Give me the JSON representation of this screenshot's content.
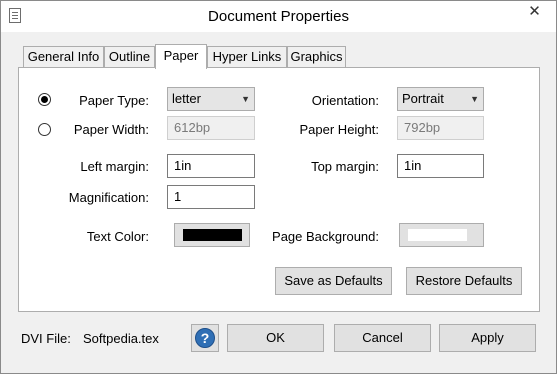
{
  "window": {
    "title": "Document Properties",
    "close_glyph": "✕"
  },
  "tabs": [
    {
      "label": "General Info"
    },
    {
      "label": "Outline"
    },
    {
      "label": "Paper"
    },
    {
      "label": "Hyper Links"
    },
    {
      "label": "Graphics"
    }
  ],
  "paper": {
    "paper_type_label": "Paper Type:",
    "paper_type_value": "letter",
    "paper_type_selected": true,
    "orientation_label": "Orientation:",
    "orientation_value": "Portrait",
    "paper_width_label": "Paper Width:",
    "paper_width_value": "612bp",
    "paper_height_label": "Paper Height:",
    "paper_height_value": "792bp",
    "left_margin_label": "Left margin:",
    "left_margin_value": "1in",
    "top_margin_label": "Top margin:",
    "top_margin_value": "1in",
    "magnification_label": "Magnification:",
    "magnification_value": "1",
    "text_color_label": "Text Color:",
    "text_color": "#000000",
    "page_background_label": "Page Background:",
    "page_background_color": "#ffffff",
    "save_defaults_label": "Save as Defaults",
    "restore_defaults_label": "Restore Defaults"
  },
  "footer": {
    "dvi_file_label": "DVI File:",
    "dvi_file_value": "Softpedia.tex",
    "help_glyph": "?",
    "ok_label": "OK",
    "cancel_label": "Cancel",
    "apply_label": "Apply"
  },
  "colors": {
    "help_icon": "#2f6fb5"
  }
}
